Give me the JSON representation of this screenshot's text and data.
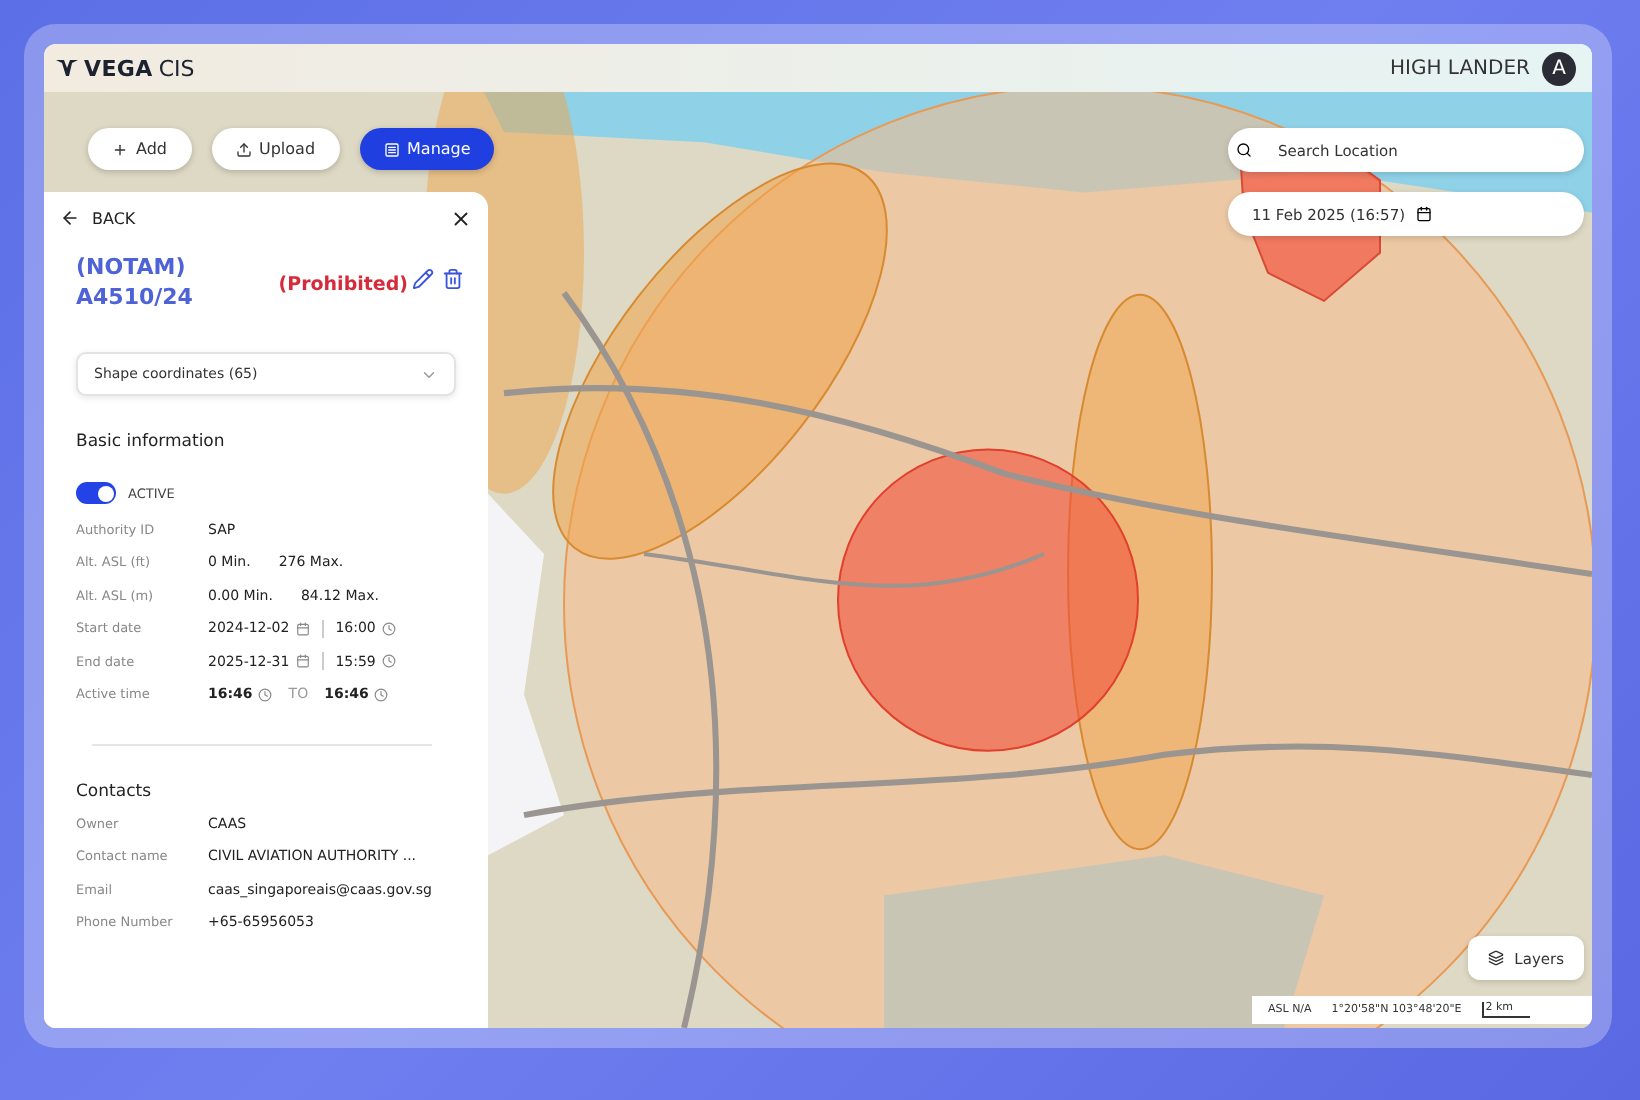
{
  "app": {
    "brand": "VEGA",
    "brand_suffix": "CIS",
    "user": "HIGH LANDER",
    "avatar": "A"
  },
  "toolbar": [
    {
      "kind": "add",
      "label": "Add",
      "selected": false
    },
    {
      "kind": "upload",
      "label": "Upload",
      "selected": false
    },
    {
      "kind": "manage",
      "label": "Manage",
      "selected": true
    }
  ],
  "panel": {
    "back": "BACK",
    "title": "(NOTAM) A4510/24",
    "status": "(Prohibited)",
    "dropdown": "Shape coordinates (65)",
    "basic_heading": "Basic information",
    "toggle": {
      "label": "ACTIVE",
      "on": true
    },
    "basic_rows": [
      {
        "kind": "text",
        "label": "Authority ID",
        "value": "SAP"
      },
      {
        "kind": "range",
        "label": "Alt. ASL (ft)",
        "min": "0 Min.",
        "max": "276 Max."
      },
      {
        "kind": "range",
        "label": "Alt. ASL (m)",
        "min": "0.00 Min.",
        "max": "84.12 Max."
      },
      {
        "kind": "datetime",
        "label": "Start date",
        "date": "2024-12-02",
        "time": "16:00"
      },
      {
        "kind": "datetime",
        "label": "End date",
        "date": "2025-12-31",
        "time": "15:59"
      },
      {
        "kind": "timerange",
        "label": "Active time",
        "from": "16:46",
        "joiner": "TO",
        "to": "16:46"
      }
    ],
    "contacts_heading": "Contacts",
    "contact_rows": [
      {
        "kind": "text",
        "label": "Owner",
        "value": "CAAS"
      },
      {
        "kind": "text",
        "label": "Contact name",
        "value": "CIVIL AVIATION AUTHORITY ..."
      },
      {
        "kind": "text",
        "label": "Email",
        "value": "caas_singaporeais@caas.gov.sg"
      },
      {
        "kind": "text",
        "label": "Phone Number",
        "value": "+65-65956053"
      }
    ]
  },
  "map": {
    "search": {
      "placeholder": "Search Location"
    },
    "date": "11 Feb 2025 (16:57)",
    "layers": "Layers",
    "status_bar": {
      "asl": "ASL N/A",
      "coords": "1°20'58\"N 103°48'20\"E",
      "scale": "2 km"
    }
  }
}
